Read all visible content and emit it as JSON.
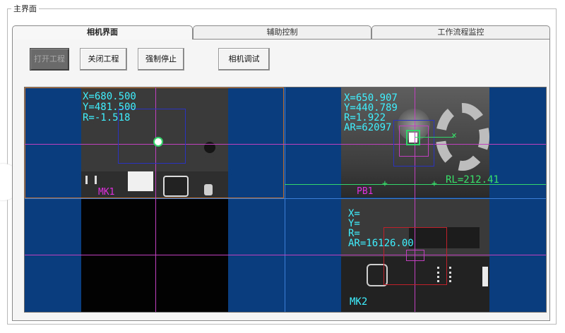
{
  "window": {
    "group_title": "主界面"
  },
  "tabs": [
    {
      "label": "相机界面",
      "active": true
    },
    {
      "label": "辅助控制",
      "active": false
    },
    {
      "label": "工作流程监控",
      "active": false
    }
  ],
  "toolbar": {
    "open_project": "打开工程",
    "close_project": "关闭工程",
    "force_stop": "强制停止",
    "camera_debug": "相机调试"
  },
  "views": {
    "top_left": {
      "x": "X=680.500",
      "y": "Y=481.500",
      "r": "R=-1.518",
      "label": "MK1"
    },
    "top_right": {
      "x": "X=650.907",
      "y": "Y=440.789",
      "r": "R=1.922",
      "ar": "AR=62097",
      "rl": "RL=212.41",
      "label": "PB1"
    },
    "bottom_right": {
      "x": "X=",
      "y": "Y=",
      "r": "R=",
      "ar": "AR=16126.00",
      "label": "MK2"
    }
  },
  "colors": {
    "cam_background": "#0a3d7d",
    "crosshair": "#c040c0",
    "divider": "#3c7fd6",
    "roi_blue": "#2a33c0",
    "roi_red": "#c0202a",
    "green_target": "#33d66a"
  }
}
